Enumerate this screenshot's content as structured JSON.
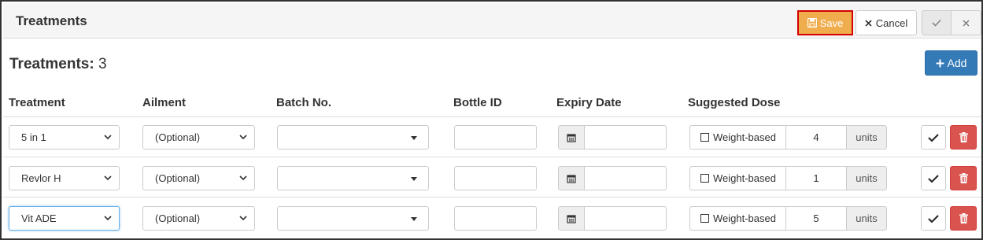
{
  "header": {
    "title": "Treatments",
    "save_label": "Save",
    "cancel_label": "Cancel"
  },
  "summary": {
    "label": "Treatments:",
    "count": "3"
  },
  "add_label": "Add",
  "columns": [
    "Treatment",
    "Ailment",
    "Batch No.",
    "Bottle ID",
    "Expiry Date",
    "Suggested Dose"
  ],
  "rows": [
    {
      "treatment": "5 in 1",
      "ailment": "(Optional)",
      "batch": "",
      "bottle_id": "",
      "expiry": "",
      "weight_based_label": "Weight-based",
      "weight_based_checked": false,
      "dose": "4",
      "units": "units"
    },
    {
      "treatment": "Revlor H",
      "ailment": "(Optional)",
      "batch": "",
      "bottle_id": "",
      "expiry": "",
      "weight_based_label": "Weight-based",
      "weight_based_checked": false,
      "dose": "1",
      "units": "units"
    },
    {
      "treatment": "Vit ADE",
      "ailment": "(Optional)",
      "batch": "",
      "bottle_id": "",
      "expiry": "",
      "weight_based_label": "Weight-based",
      "weight_based_checked": false,
      "dose": "5",
      "units": "units"
    }
  ],
  "colors": {
    "save": "#f0ad4e",
    "save_highlight": "#d40000",
    "add": "#337ab7",
    "delete": "#d9534f"
  },
  "icons": {
    "save": "floppy-disk-icon",
    "cancel": "x-icon",
    "ok": "checkmark-icon",
    "close": "x-icon",
    "add": "plus-icon",
    "date": "calendar-icon",
    "delete": "trash-icon"
  }
}
